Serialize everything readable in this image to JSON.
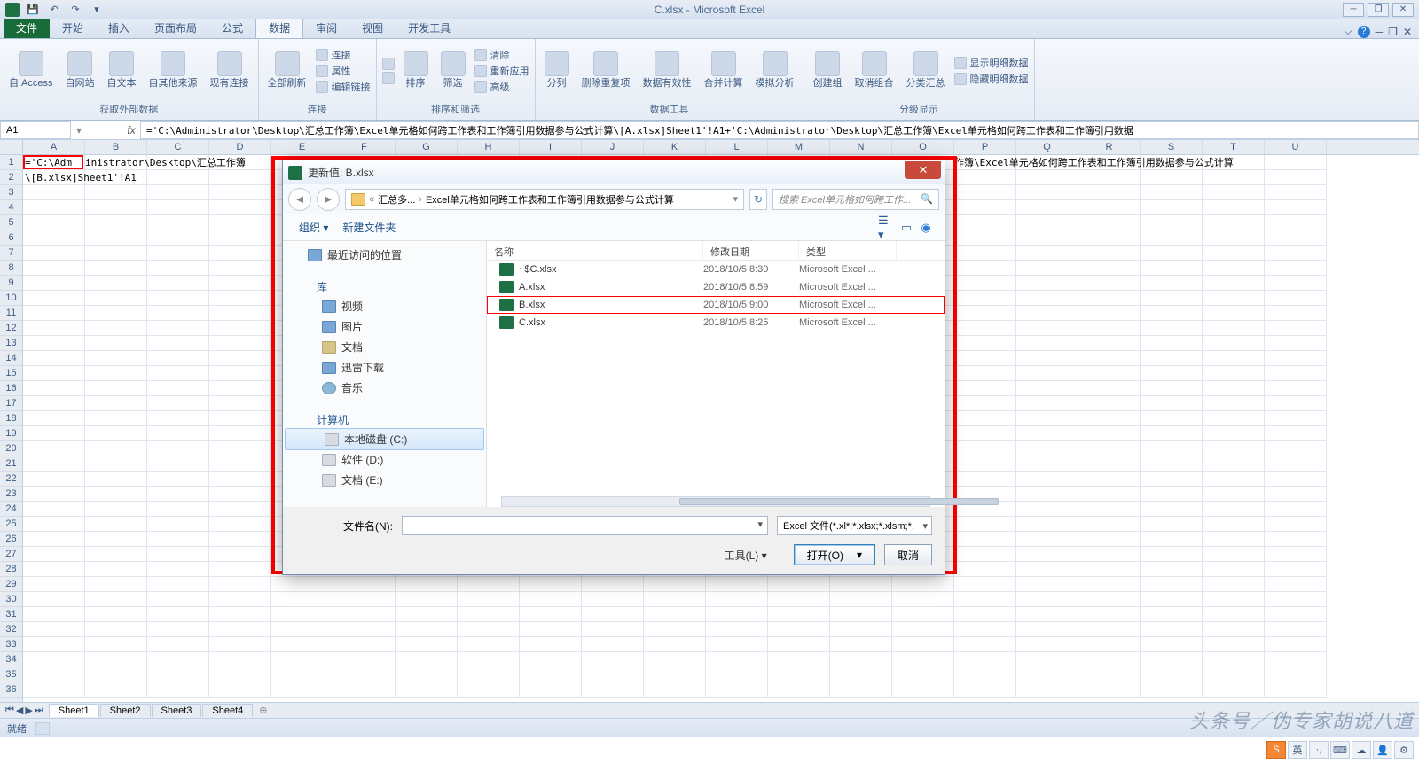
{
  "window": {
    "title": "C.xlsx - Microsoft Excel"
  },
  "tabs": {
    "file": "文件",
    "home": "开始",
    "insert": "插入",
    "layout": "页面布局",
    "formulas": "公式",
    "data": "数据",
    "review": "审阅",
    "view": "视图",
    "dev": "开发工具"
  },
  "ribbon": {
    "ext_data": {
      "access": "自 Access",
      "web": "自网站",
      "text": "自文本",
      "other": "自其他来源",
      "existing": "现有连接",
      "label": "获取外部数据"
    },
    "conn": {
      "refresh": "全部刷新",
      "connections": "连接",
      "properties": "属性",
      "editlinks": "编辑链接",
      "label": "连接"
    },
    "sort": {
      "az": "↓A↑Z",
      "sort": "排序",
      "filter": "筛选",
      "clear": "清除",
      "reapply": "重新应用",
      "adv": "高级",
      "label": "排序和筛选"
    },
    "tools": {
      "ttc": "分列",
      "dup": "删除重复项",
      "valid": "数据有效性",
      "consol": "合并计算",
      "whatif": "模拟分析",
      "label": "数据工具"
    },
    "outline": {
      "group": "创建组",
      "ungroup": "取消组合",
      "subtotal": "分类汇总",
      "showdet": "显示明细数据",
      "hidedet": "隐藏明细数据",
      "label": "分级显示"
    }
  },
  "namebox": "A1",
  "formula": "='C:\\Administrator\\Desktop\\汇总工作簿\\Excel单元格如何跨工作表和工作簿引用数据参与公式计算\\[A.xlsx]Sheet1'!A1+'C:\\Administrator\\Desktop\\汇总工作簿\\Excel单元格如何跨工作表和工作簿引用数据",
  "columns": [
    "A",
    "B",
    "C",
    "D",
    "E",
    "F",
    "G",
    "H",
    "I",
    "J",
    "K",
    "L",
    "M",
    "N",
    "O",
    "P",
    "Q",
    "R",
    "S",
    "T",
    "U"
  ],
  "cell_a1_part1": "='C:\\Adm",
  "cell_row1_rest": "inistrator\\Desktop\\汇总工作簿",
  "cell_row1_right": "作簿\\Excel单元格如何跨工作表和工作簿引用数据参与公式计算",
  "cell_a2": "\\[B.xlsx]Sheet1'!A1",
  "sheets": [
    "Sheet1",
    "Sheet2",
    "Sheet3",
    "Sheet4"
  ],
  "status": "就绪",
  "dialog": {
    "title": "更新值: B.xlsx",
    "crumb1": "汇总多...",
    "crumb2": "Excel单元格如何跨工作表和工作簿引用数据参与公式计算",
    "search_ph": "搜索 Excel单元格如何跨工作...",
    "organize": "组织 ▾",
    "newfolder": "新建文件夹",
    "sidebar": {
      "recent": "最近访问的位置",
      "lib": "库",
      "video": "视频",
      "pic": "图片",
      "doc": "文档",
      "xunlei": "迅雷下载",
      "music": "音乐",
      "computer": "计算机",
      "c": "本地磁盘 (C:)",
      "d": "软件 (D:)",
      "e": "文档 (E:)"
    },
    "cols": {
      "name": "名称",
      "date": "修改日期",
      "type": "类型"
    },
    "files": [
      {
        "name": "~$C.xlsx",
        "date": "2018/10/5 8:30",
        "type": "Microsoft Excel ..."
      },
      {
        "name": "A.xlsx",
        "date": "2018/10/5 8:59",
        "type": "Microsoft Excel ..."
      },
      {
        "name": "B.xlsx",
        "date": "2018/10/5 9:00",
        "type": "Microsoft Excel ..."
      },
      {
        "name": "C.xlsx",
        "date": "2018/10/5 8:25",
        "type": "Microsoft Excel ..."
      }
    ],
    "fn_label": "文件名(N):",
    "filter": "Excel 文件(*.xl*;*.xlsx;*.xlsm;*.",
    "tools": "工具(L)  ▾",
    "open": "打开(O)",
    "cancel": "取消"
  },
  "watermark": "头条号／伪专家胡说八道"
}
